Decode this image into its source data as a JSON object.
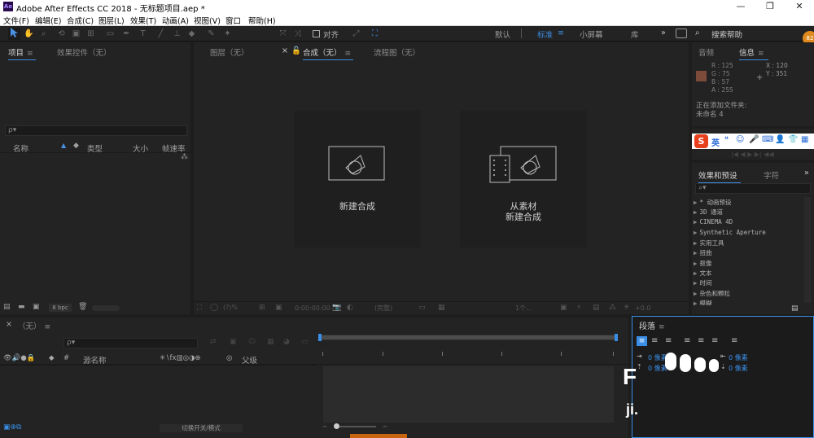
{
  "window": {
    "app_icon": "Ae",
    "title": "Adobe After Effects CC 2018 - 无标题项目.aep *",
    "minimize": "—",
    "maximize": "❐",
    "close": "✕"
  },
  "menu": [
    "文件(F)",
    "编辑(E)",
    "合成(C)",
    "图层(L)",
    "效果(T)",
    "动画(A)",
    "视图(V)",
    "窗口",
    "帮助(H)"
  ],
  "toolbar": {
    "snap_label": "对齐",
    "workspaces": [
      "默认",
      "标准",
      "小屏幕",
      "库"
    ],
    "active_workspace": "标准",
    "overflow": "»",
    "search_help": "搜索帮助"
  },
  "project_panel": {
    "tabs": [
      "项目",
      "效果控件（无）"
    ],
    "search_placeholder": "ρ▾",
    "columns": [
      "名称",
      "类型",
      "大小",
      "帧速率"
    ],
    "bpc": "8 bpc"
  },
  "center_panel": {
    "tabs": [
      "图层（无）",
      "合成（无）",
      "流程图（无）"
    ],
    "card_new": "新建合成",
    "card_from_footage_1": "从素材",
    "card_from_footage_2": "新建合成",
    "viewer_zoom": "(?)%",
    "viewer_time": "0:00:00:00",
    "viewer_quality": "(完整)",
    "viewer_view": "1个...",
    "viewer_offset": "+0.0"
  },
  "info_panel": {
    "tabs": [
      "音频",
      "信息"
    ],
    "r": "R : 125",
    "g": "G : 75",
    "b": "B : 57",
    "a": "A : 255",
    "x": "X : 120",
    "y": "Y : 351",
    "color_swatch": "#7d4b39",
    "status_1": "正在添加文件夹:",
    "status_2": "未命名 4"
  },
  "ime_bar": {
    "label": "英",
    "brand_color": "#e8401c"
  },
  "effects_panel": {
    "tabs": [
      "效果和预设",
      "字符"
    ],
    "items": [
      "* 动画预设",
      "3D 通道",
      "CINEMA 4D",
      "Synthetic Aperture",
      "实用工具",
      "扭曲",
      "抠像",
      "文本",
      "时间",
      "杂色和颗粒",
      "模糊"
    ]
  },
  "timeline": {
    "tab": "（无）",
    "columns": [
      "源名称",
      "父级"
    ],
    "toggle_label": "切换开关/模式"
  },
  "paragraph_panel": {
    "title": "段落",
    "indent_1": "0 像素",
    "indent_2": "0 像素",
    "indent_3": "0 像素",
    "indent_4": "0 像素",
    "overlay_1": "F",
    "overlay_2": "ji."
  }
}
